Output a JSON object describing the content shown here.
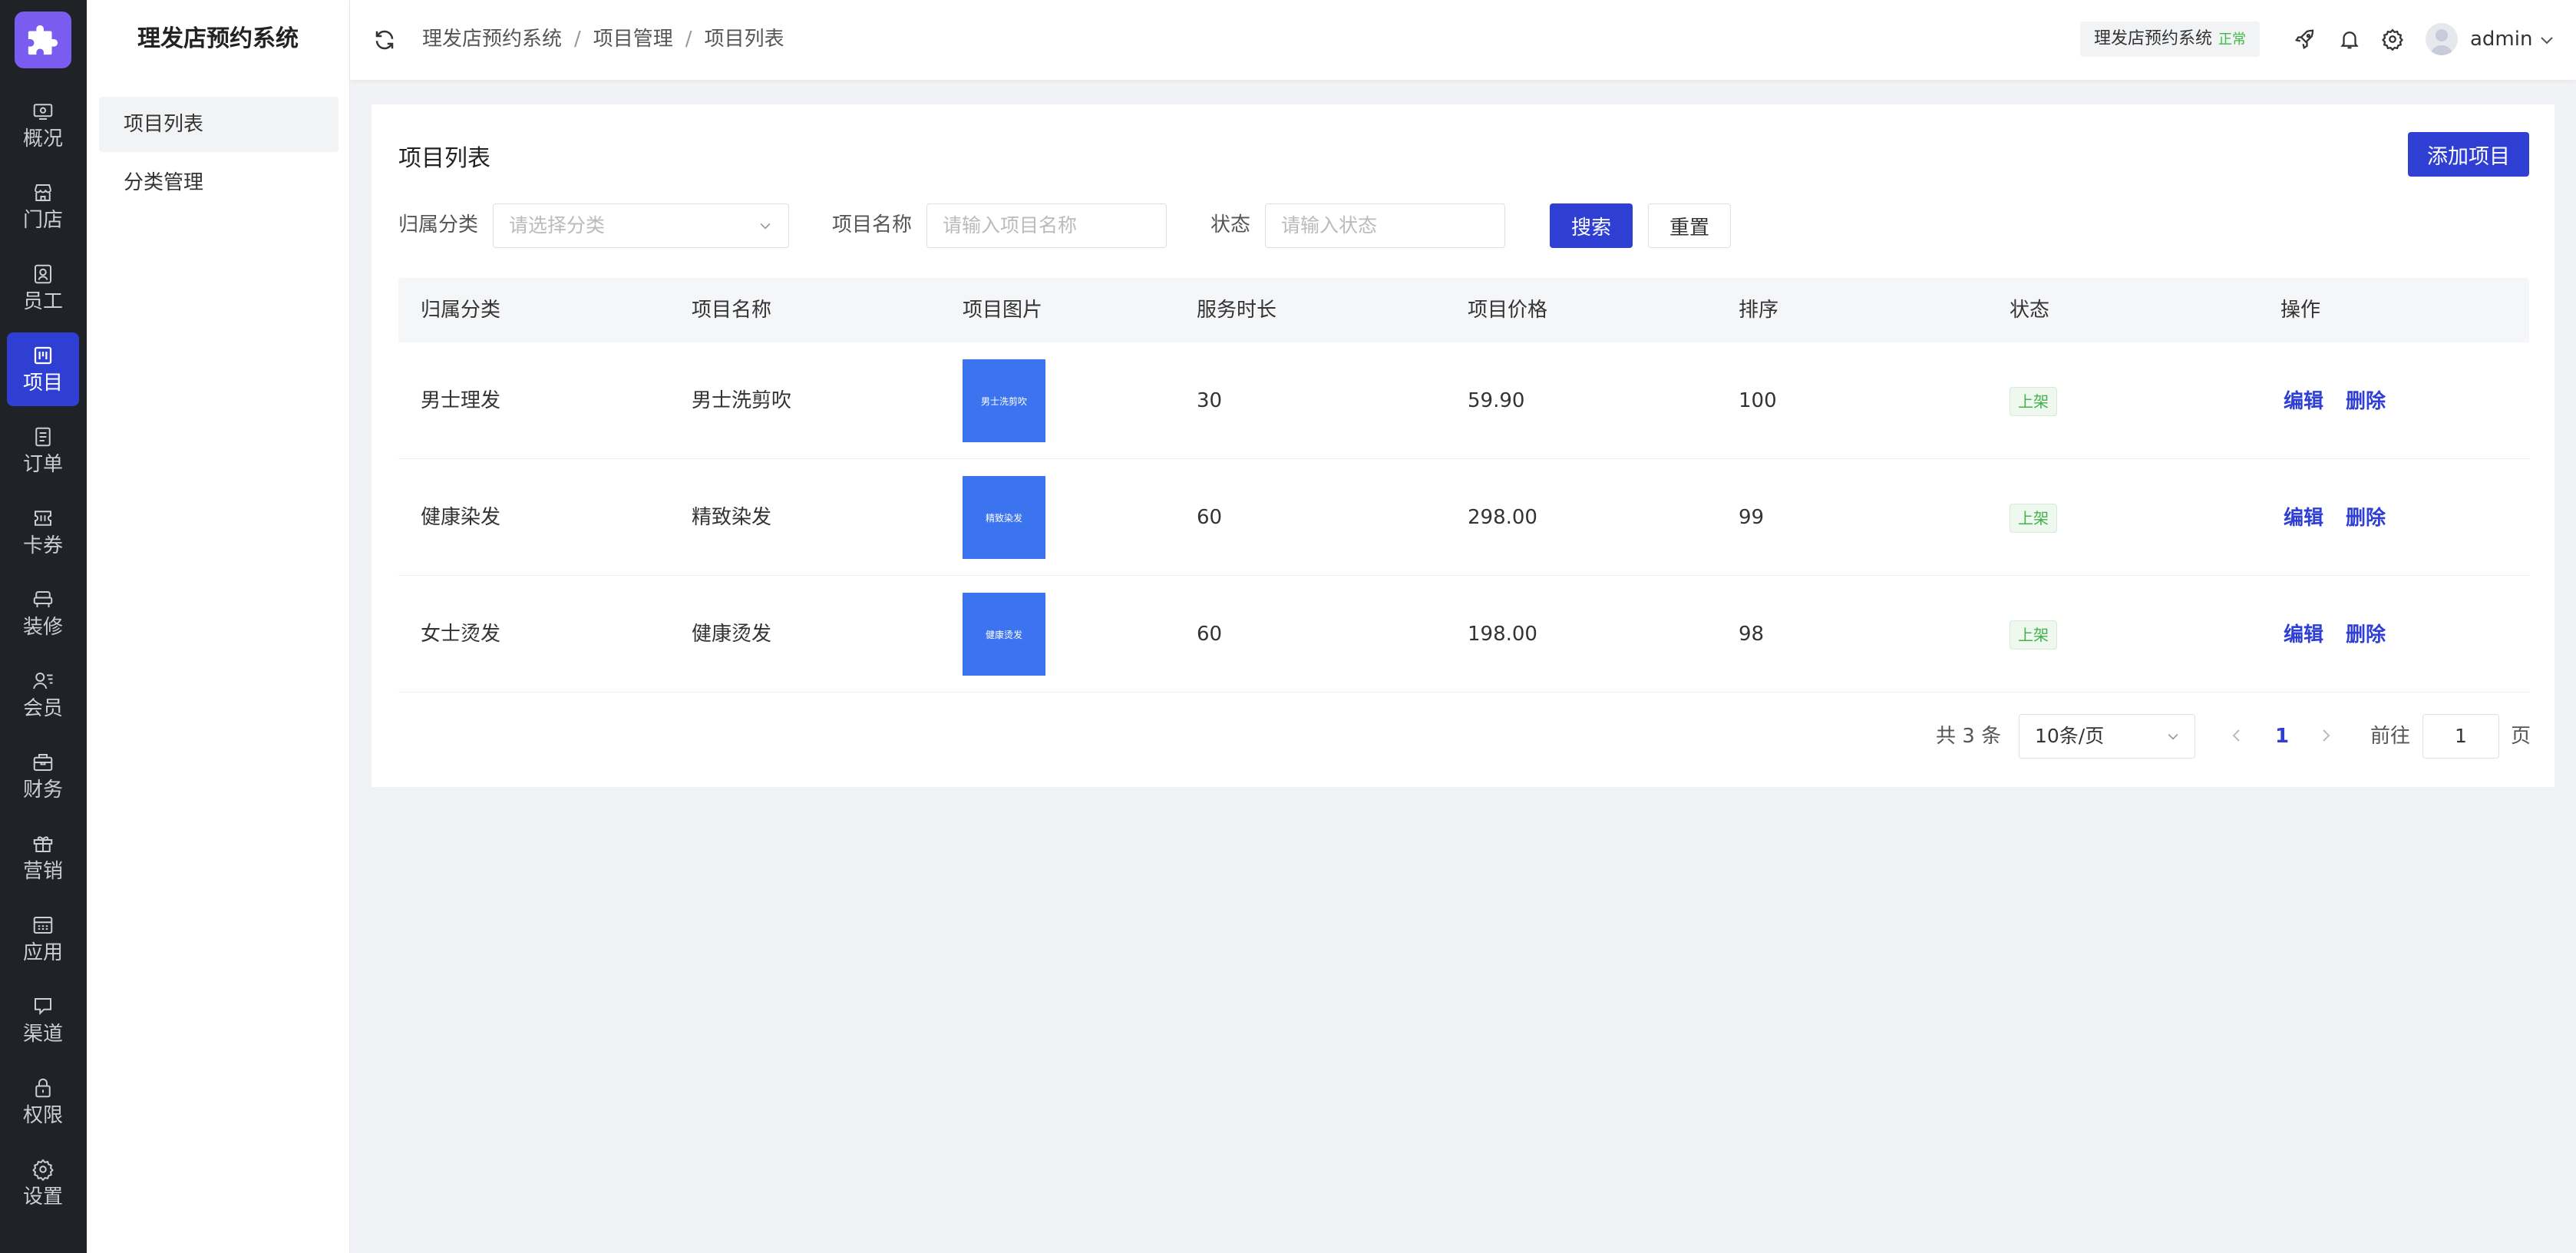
{
  "sidebar": {
    "items": [
      {
        "label": "概况",
        "icon": "dashboard-icon"
      },
      {
        "label": "门店",
        "icon": "store-icon"
      },
      {
        "label": "员工",
        "icon": "staff-icon"
      },
      {
        "label": "项目",
        "icon": "project-icon",
        "active": true
      },
      {
        "label": "订单",
        "icon": "order-icon"
      },
      {
        "label": "卡券",
        "icon": "coupon-icon"
      },
      {
        "label": "装修",
        "icon": "decorate-icon"
      },
      {
        "label": "会员",
        "icon": "member-icon"
      },
      {
        "label": "财务",
        "icon": "finance-icon"
      },
      {
        "label": "营销",
        "icon": "gift-icon"
      },
      {
        "label": "应用",
        "icon": "apps-icon"
      },
      {
        "label": "渠道",
        "icon": "channel-icon"
      },
      {
        "label": "权限",
        "icon": "lock-icon"
      },
      {
        "label": "设置",
        "icon": "settings-icon"
      }
    ]
  },
  "submenu": {
    "title": "理发店预约系统",
    "items": [
      {
        "label": "项目列表"
      },
      {
        "label": "分类管理"
      }
    ]
  },
  "header": {
    "breadcrumb": [
      "理发店预约系统",
      "项目管理",
      "项目列表"
    ],
    "breadcrumb_sep": "/",
    "store_name": "理发店预约系统",
    "store_status": "正常",
    "username": "admin"
  },
  "page": {
    "title": "项目列表",
    "add_button": "添加项目"
  },
  "filters": {
    "category_label": "归属分类",
    "category_placeholder": "请选择分类",
    "name_label": "项目名称",
    "name_placeholder": "请输入项目名称",
    "status_label": "状态",
    "status_placeholder": "请输入状态",
    "search_button": "搜索",
    "reset_button": "重置"
  },
  "table": {
    "columns": [
      "归属分类",
      "项目名称",
      "项目图片",
      "服务时长",
      "项目价格",
      "排序",
      "状态",
      "操作"
    ],
    "rows": [
      {
        "category": "男士理发",
        "name": "男士洗剪吹",
        "image_text": "男士洗剪吹",
        "duration": "30",
        "price": "59.90",
        "sort": "100",
        "status": "上架",
        "edit": "编辑",
        "delete": "删除"
      },
      {
        "category": "健康染发",
        "name": "精致染发",
        "image_text": "精致染发",
        "duration": "60",
        "price": "298.00",
        "sort": "99",
        "status": "上架",
        "edit": "编辑",
        "delete": "删除"
      },
      {
        "category": "女士烫发",
        "name": "健康烫发",
        "image_text": "健康烫发",
        "duration": "60",
        "price": "198.00",
        "sort": "98",
        "status": "上架",
        "edit": "编辑",
        "delete": "删除"
      }
    ]
  },
  "pagination": {
    "total_text": "共 3 条",
    "page_size": "10条/页",
    "current_page": "1",
    "goto_label": "前往",
    "goto_value": "1",
    "page_suffix": "页"
  },
  "colors": {
    "primary": "#2f3fd4",
    "rail_bg": "#1f2227",
    "logo": "#7a5cf0",
    "status_green": "#46b04f"
  }
}
